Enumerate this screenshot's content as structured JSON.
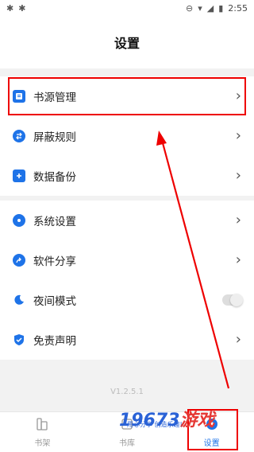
{
  "status_bar": {
    "left_icons": [
      "bug-icon",
      "bug-icon"
    ],
    "time": "2:55"
  },
  "header": {
    "title": "设置"
  },
  "group1": [
    {
      "label": "书源管理",
      "icon": "book-source-icon",
      "type": "chevron"
    },
    {
      "label": "屏蔽规则",
      "icon": "swap-icon",
      "type": "chevron"
    },
    {
      "label": "数据备份",
      "icon": "plus-icon",
      "type": "chevron"
    }
  ],
  "group2": [
    {
      "label": "系统设置",
      "icon": "hexagon-gear-icon",
      "type": "chevron"
    },
    {
      "label": "软件分享",
      "icon": "share-icon",
      "type": "chevron"
    },
    {
      "label": "夜间模式",
      "icon": "moon-icon",
      "type": "toggle",
      "value": false
    },
    {
      "label": "免责声明",
      "icon": "shield-check-icon",
      "type": "chevron"
    }
  ],
  "version": "V1.2.5.1",
  "tabs": [
    {
      "label": "书架",
      "active": false
    },
    {
      "label": "书库",
      "active": false
    },
    {
      "label": "设置",
      "active": true
    }
  ],
  "watermark": {
    "brand_num": "19673",
    "brand_text": "游戏",
    "slogan": "用心分享 创造乐趣!"
  },
  "colors": {
    "accent": "#1e73e8",
    "highlight": "#e00000"
  }
}
